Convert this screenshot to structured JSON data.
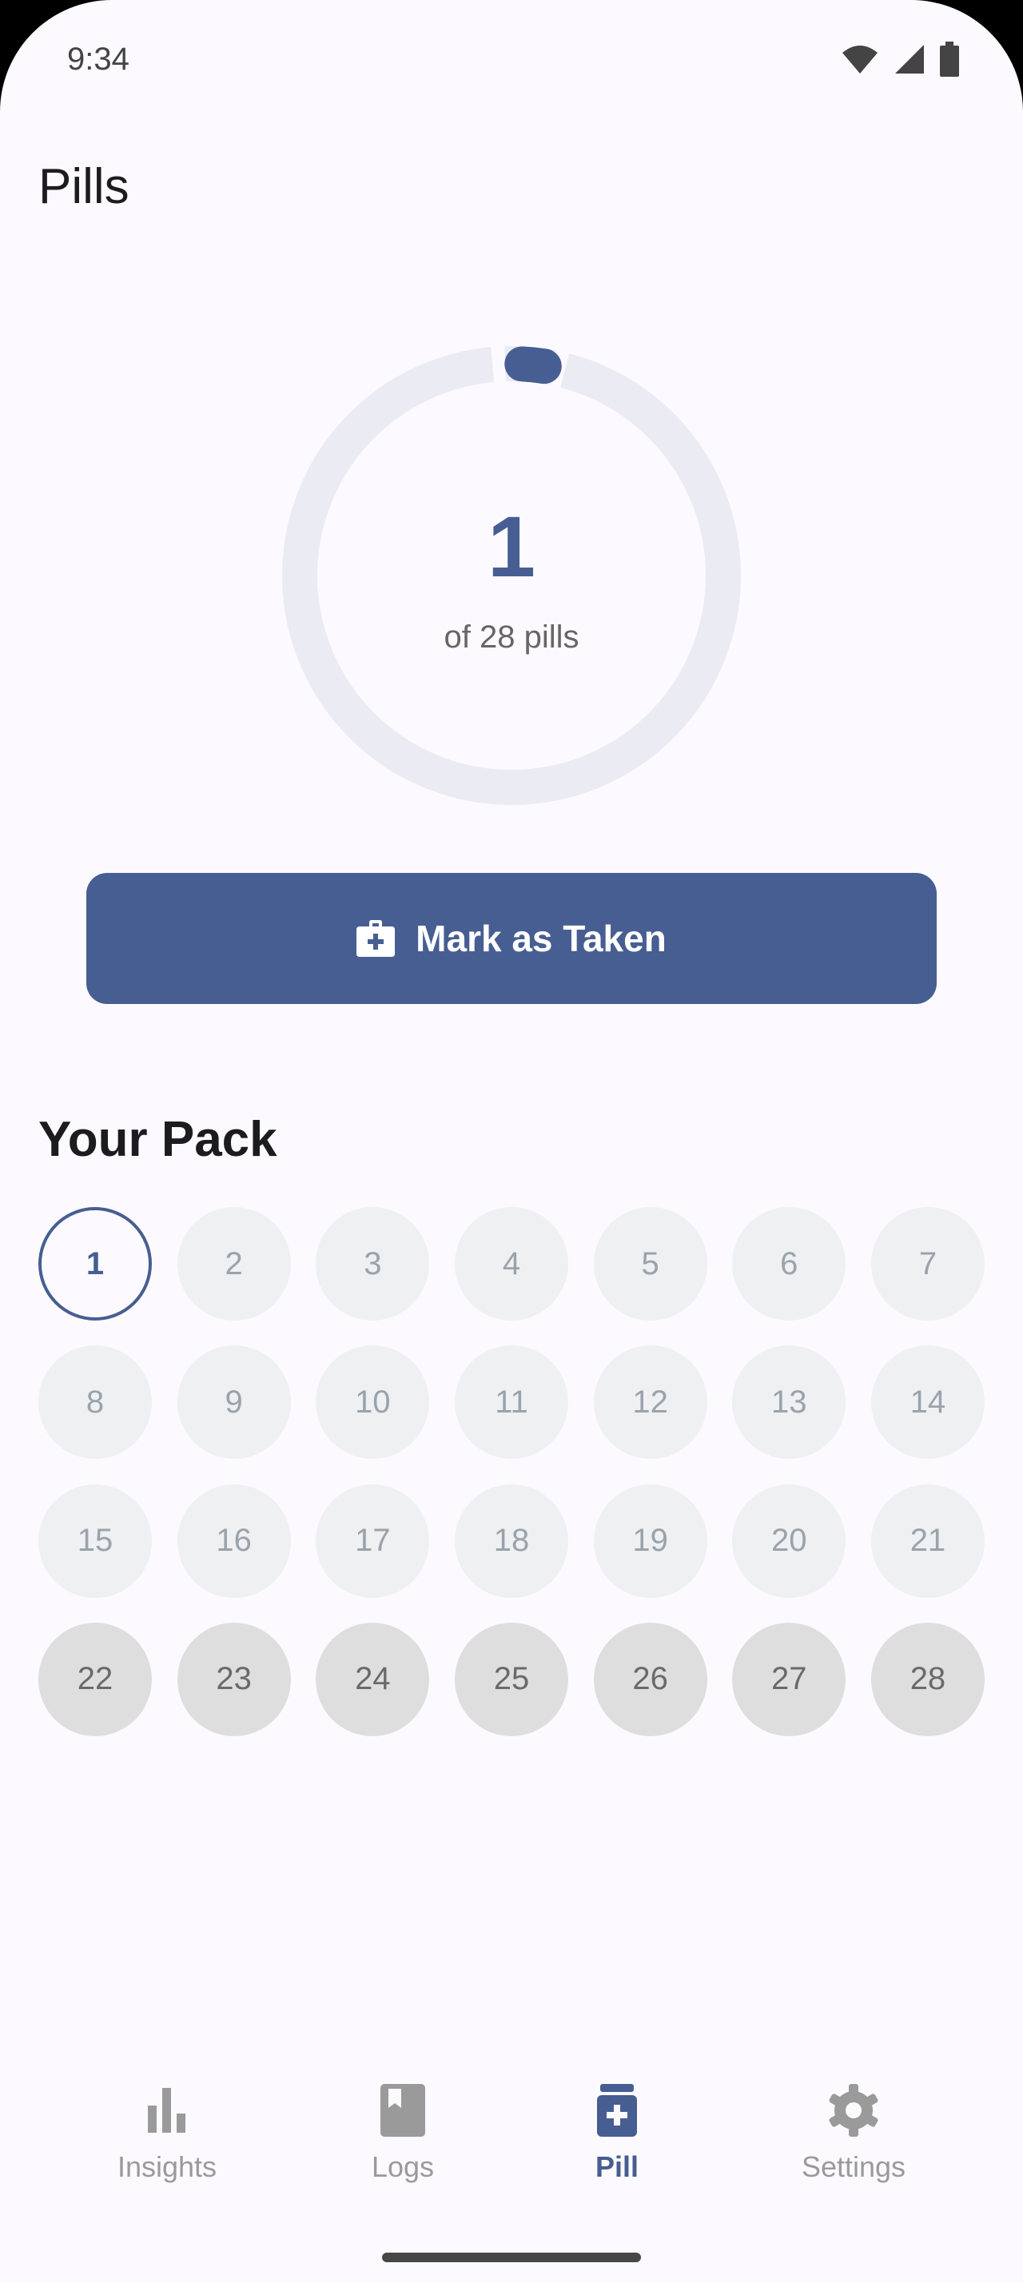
{
  "status_bar": {
    "time": "9:34"
  },
  "header": {
    "title": "Pills"
  },
  "progress": {
    "taken": "1",
    "subtitle": "of 28 pills",
    "current_index": 1,
    "total": 28
  },
  "actions": {
    "mark_taken_label": "Mark as Taken"
  },
  "pack": {
    "title": "Your Pack",
    "pills": [
      {
        "n": "1",
        "state": "current"
      },
      {
        "n": "2",
        "state": "active"
      },
      {
        "n": "3",
        "state": "active"
      },
      {
        "n": "4",
        "state": "active"
      },
      {
        "n": "5",
        "state": "active"
      },
      {
        "n": "6",
        "state": "active"
      },
      {
        "n": "7",
        "state": "active"
      },
      {
        "n": "8",
        "state": "active"
      },
      {
        "n": "9",
        "state": "active"
      },
      {
        "n": "10",
        "state": "active"
      },
      {
        "n": "11",
        "state": "active"
      },
      {
        "n": "12",
        "state": "active"
      },
      {
        "n": "13",
        "state": "active"
      },
      {
        "n": "14",
        "state": "active"
      },
      {
        "n": "15",
        "state": "active"
      },
      {
        "n": "16",
        "state": "active"
      },
      {
        "n": "17",
        "state": "active"
      },
      {
        "n": "18",
        "state": "active"
      },
      {
        "n": "19",
        "state": "active"
      },
      {
        "n": "20",
        "state": "active"
      },
      {
        "n": "21",
        "state": "active"
      },
      {
        "n": "22",
        "state": "placebo"
      },
      {
        "n": "23",
        "state": "placebo"
      },
      {
        "n": "24",
        "state": "placebo"
      },
      {
        "n": "25",
        "state": "placebo"
      },
      {
        "n": "26",
        "state": "placebo"
      },
      {
        "n": "27",
        "state": "placebo"
      },
      {
        "n": "28",
        "state": "placebo"
      }
    ]
  },
  "nav": {
    "items": [
      {
        "label": "Insights",
        "icon": "bar-chart-icon",
        "active": false
      },
      {
        "label": "Logs",
        "icon": "book-icon",
        "active": false
      },
      {
        "label": "Pill",
        "icon": "pill-bottle-icon",
        "active": true
      },
      {
        "label": "Settings",
        "icon": "gear-icon",
        "active": false
      }
    ]
  },
  "colors": {
    "accent": "#475e92",
    "background": "#fcfafe",
    "ring_track": "#ebebf3",
    "pill_active": "#eef0f2",
    "pill_placebo": "#dedede"
  }
}
